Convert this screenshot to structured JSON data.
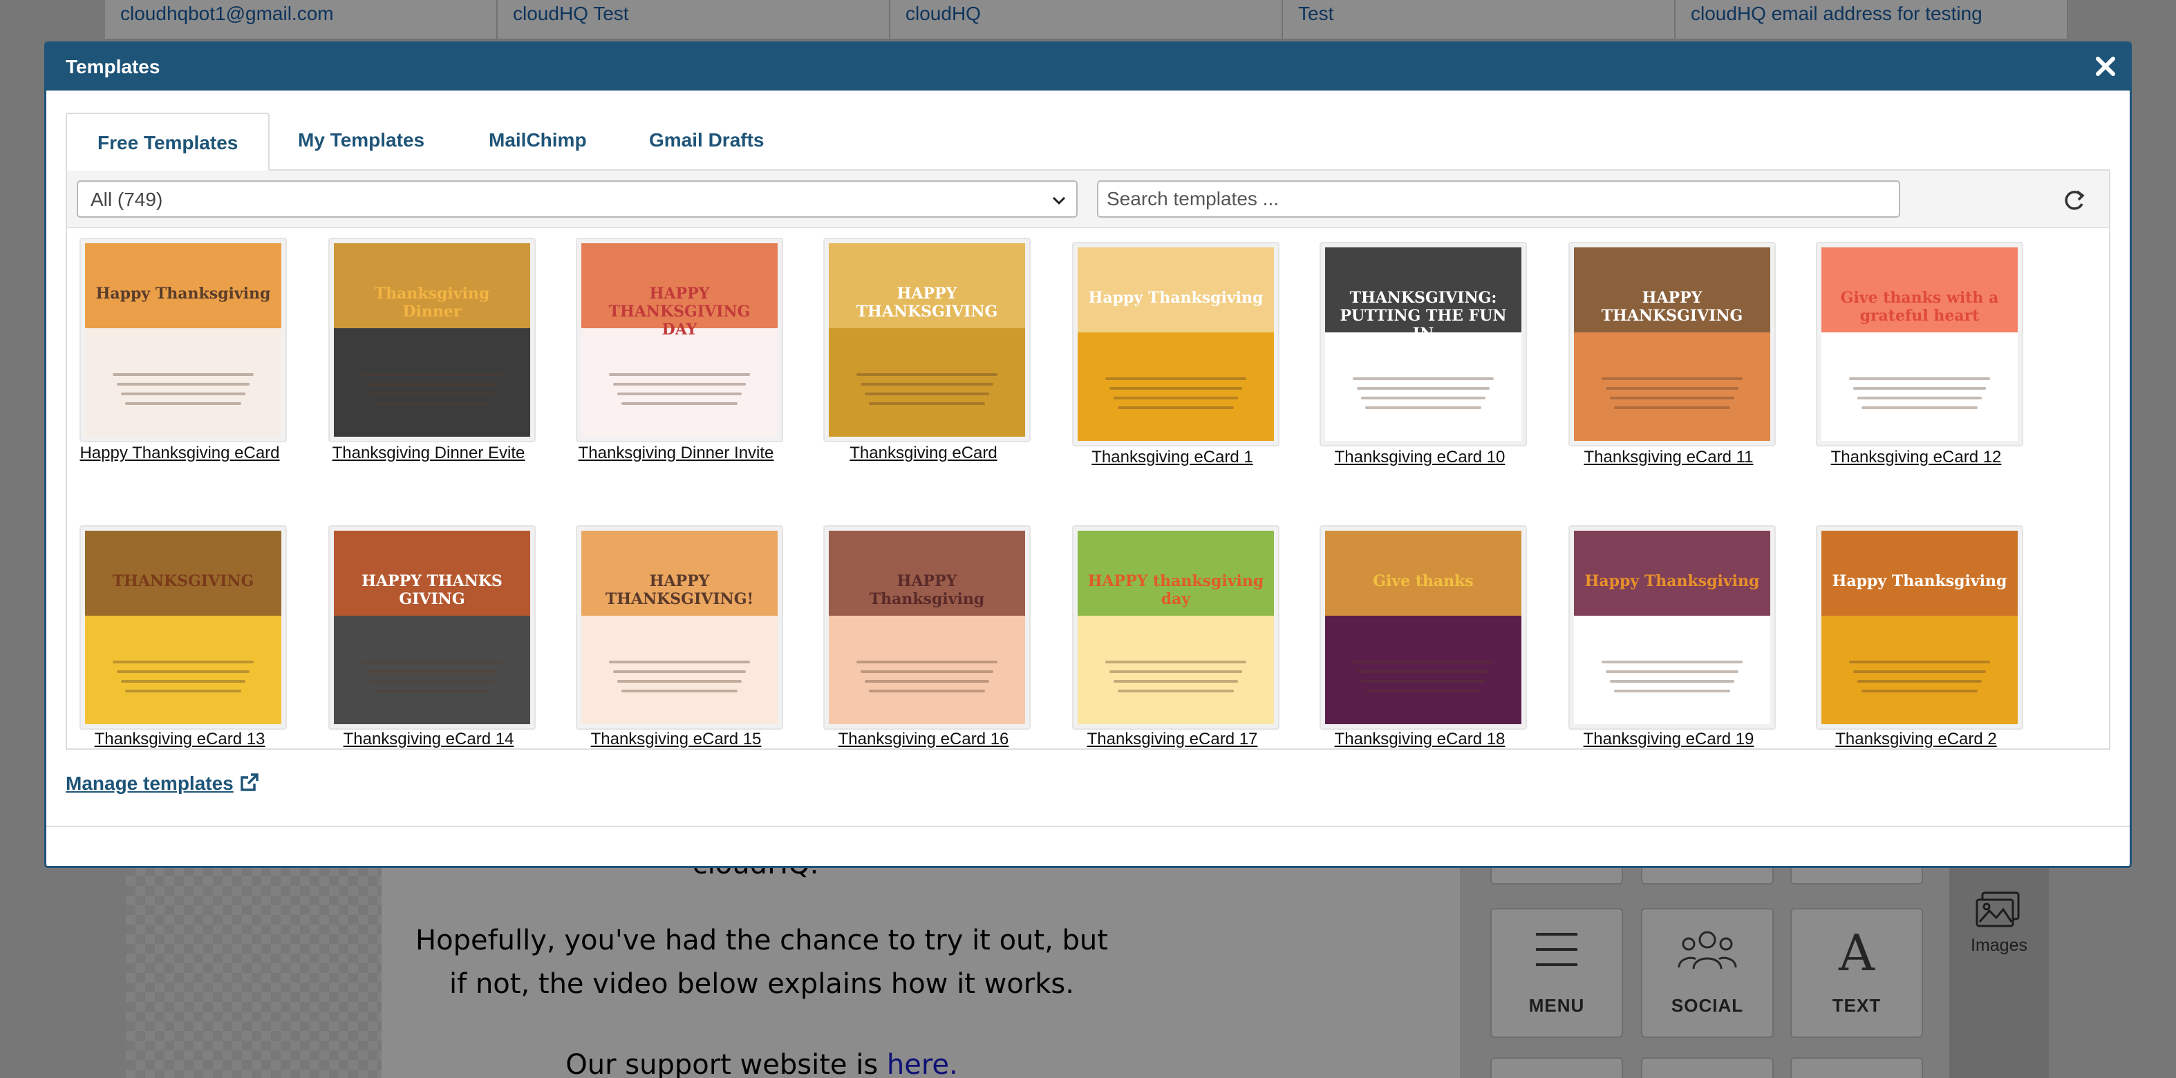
{
  "background": {
    "table_row": [
      "cloudhqbot1@gmail.com",
      "cloudHQ Test",
      "cloudHQ",
      "Test",
      "cloudHQ email address for testing"
    ],
    "email_cut_text": "cloudHQ.",
    "email_paragraph": "Hopefully, you've had the chance to try it out, but if not, the video below explains how it works.",
    "support_prefix": "Our support website is ",
    "support_link": "here.",
    "tiles": [
      {
        "label": "MENU",
        "icon": "menu-icon"
      },
      {
        "label": "SOCIAL",
        "icon": "social-icon"
      },
      {
        "label": "TEXT",
        "icon": "text-icon"
      }
    ],
    "side_images_label": "Images"
  },
  "modal": {
    "title": "Templates",
    "close_icon": "close-icon",
    "tabs": [
      "Free Templates",
      "My Templates",
      "MailChimp",
      "Gmail Drafts"
    ],
    "active_tab": "Free Templates",
    "filter_value": "All (749)",
    "search_placeholder": "Search templates ...",
    "refresh_icon": "refresh-icon",
    "manage_link": "Manage templates",
    "manage_link_icon": "external-link-icon"
  },
  "templates": [
    {
      "name": "Happy Thanksgiving eCard",
      "bg": "#f6ede6",
      "accent": "#e8912b",
      "headline": "Happy Thanksgiving",
      "headline_color": "#5a3d2b"
    },
    {
      "name": "Thanksgiving Dinner Evite",
      "bg": "#3c3c3c",
      "accent": "#e8a73a",
      "headline": "Thanksgiving Dinner",
      "headline_color": "#f2b443"
    },
    {
      "name": "Thanksgiving Dinner Invite",
      "bg": "#fbf1f1",
      "accent": "#e06a3a",
      "headline": "HAPPY THANKSGIVING DAY",
      "headline_color": "#c23a3a"
    },
    {
      "name": "Thanksgiving eCard",
      "bg": "#cf9a2c",
      "accent": "#e9c066",
      "headline": "HAPPY THANKSGIVING",
      "headline_color": "#ffffff"
    },
    {
      "name": "Thanksgiving eCard 1",
      "bg": "#e8a51c",
      "accent": "#f4d69a",
      "headline": "Happy Thanksgiving",
      "headline_color": "#ffffff"
    },
    {
      "name": "Thanksgiving eCard 10",
      "bg": "#ffffff",
      "accent": "#222222",
      "headline": "THANKSGIVING: PUTTING THE FUN IN",
      "headline_color": "#ffffff"
    },
    {
      "name": "Thanksgiving eCard 11",
      "bg": "#e0884a",
      "accent": "#7b5a3a",
      "headline": "HAPPY THANKSGIVING",
      "headline_color": "#ffffff"
    },
    {
      "name": "Thanksgiving eCard 12",
      "bg": "#ffffff",
      "accent": "#f26b4a",
      "headline": "Give thanks with a grateful heart",
      "headline_color": "#e04a3a"
    },
    {
      "name": "Thanksgiving eCard 13",
      "bg": "#f2c232",
      "accent": "#8a5a2a",
      "headline": "THANKSGIVING",
      "headline_color": "#7a3a1a"
    },
    {
      "name": "Thanksgiving eCard 14",
      "bg": "#4a4a4a",
      "accent": "#c85a2a",
      "headline": "HAPPY THANKS GIVING",
      "headline_color": "#ffffff"
    },
    {
      "name": "Thanksgiving eCard 15",
      "bg": "#fbe9dd",
      "accent": "#e89a4a",
      "headline": "HAPPY THANKSGIVING!",
      "headline_color": "#5a3a2a"
    },
    {
      "name": "Thanksgiving eCard 16",
      "bg": "#f6c9ad",
      "accent": "#8a4a3a",
      "headline": "HAPPY Thanksgiving",
      "headline_color": "#5a2a2a"
    },
    {
      "name": "Thanksgiving eCard 17",
      "bg": "#fbe6a3",
      "accent": "#7ab23a",
      "headline": "HAPPY thanksgiving day",
      "headline_color": "#e05a2a"
    },
    {
      "name": "Thanksgiving eCard 18",
      "bg": "#5a1e4a",
      "accent": "#e8a53a",
      "headline": "Give thanks",
      "headline_color": "#f2c040"
    },
    {
      "name": "Thanksgiving eCard 19",
      "bg": "#ffffff",
      "accent": "#6a1e3a",
      "headline": "Happy Thanksgiving",
      "headline_color": "#e8912b"
    },
    {
      "name": "Thanksgiving eCard 2",
      "bg": "#e8a51c",
      "accent": "#c86a2a",
      "headline": "Happy Thanksgiving",
      "headline_color": "#ffffff"
    }
  ],
  "colors": {
    "header_bg": "#1e5478",
    "link": "#1e5478"
  }
}
